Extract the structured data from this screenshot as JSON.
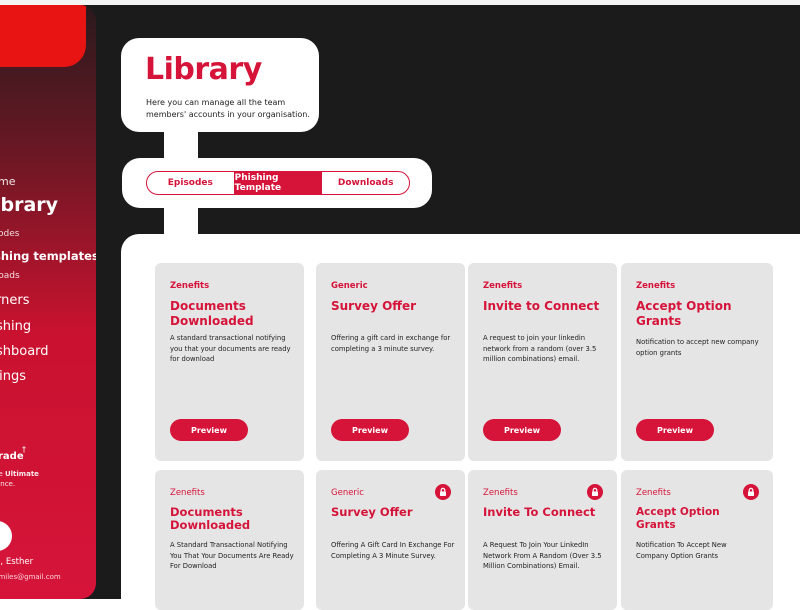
{
  "sidebar": {
    "nav": {
      "home": "me",
      "library": "ibrary",
      "episodes": "odes",
      "phishing_templates": "shing templates",
      "downloads": "nloads",
      "learners": "rners",
      "phishing": "shing",
      "dashboard": "shboard",
      "settings": "tings"
    },
    "upgrade": {
      "label": "rade",
      "sup": "†",
      "desc_prefix": "he ",
      "desc_strong": "Ultimate",
      "desc_suffix": "ience."
    },
    "user": {
      "name": "s, Esther",
      "email": "r.miles@gmail.com"
    }
  },
  "header": {
    "title": "Library",
    "subtitle": "Here you can manage all the team members' accounts in your organisation."
  },
  "tabs": [
    {
      "label": "Episodes",
      "active": false
    },
    {
      "label": "Phishing Template",
      "active": true
    },
    {
      "label": "Downloads",
      "active": false
    }
  ],
  "cards": [
    {
      "category": "Zenefits",
      "title": "Documents Downloaded",
      "description": "A standard transactional notifying you that your documents are ready for download",
      "button": "Preview",
      "locked": false
    },
    {
      "category": "Generic",
      "title": "Survey Offer",
      "description": "Offering a gift card in exchange for completing a 3 minute survey.",
      "button": "Preview",
      "locked": false
    },
    {
      "category": "Zenefits",
      "title": "Invite to Connect",
      "description": "A request to join your linkedin network from a random (over 3.5 million combinations) email.",
      "button": "Preview",
      "locked": false
    },
    {
      "category": "Zenefits",
      "title": "Accept Option Grants",
      "description": "Notification to accept new company option grants",
      "button": "Preview",
      "locked": false
    },
    {
      "category": "Zenefits",
      "title": "Documents Downloaded",
      "description": "A Standard Transactional Notifying You That Your Documents Are Ready For Download",
      "locked": false
    },
    {
      "category": "Generic",
      "title": "Survey Offer",
      "description": "Offering A Gift Card In Exchange For Completing A 3 Minute Survey.",
      "locked": true
    },
    {
      "category": "Zenefits",
      "title": "Invite To Connect",
      "description": "A Request To Join Your LinkedIn Network From A Random (Over 3.5 Million Combinations) Email.",
      "locked": true
    },
    {
      "category": "Zenefits",
      "title": "Accept Option Grants",
      "description": "Notification To Accept New Company Option Grants",
      "locked": true
    }
  ],
  "colors": {
    "accent": "#d6143a",
    "dark_bg": "#1b1b1c",
    "card_bg": "#e5e5e6"
  },
  "icons": {
    "lock": "lock-icon"
  }
}
